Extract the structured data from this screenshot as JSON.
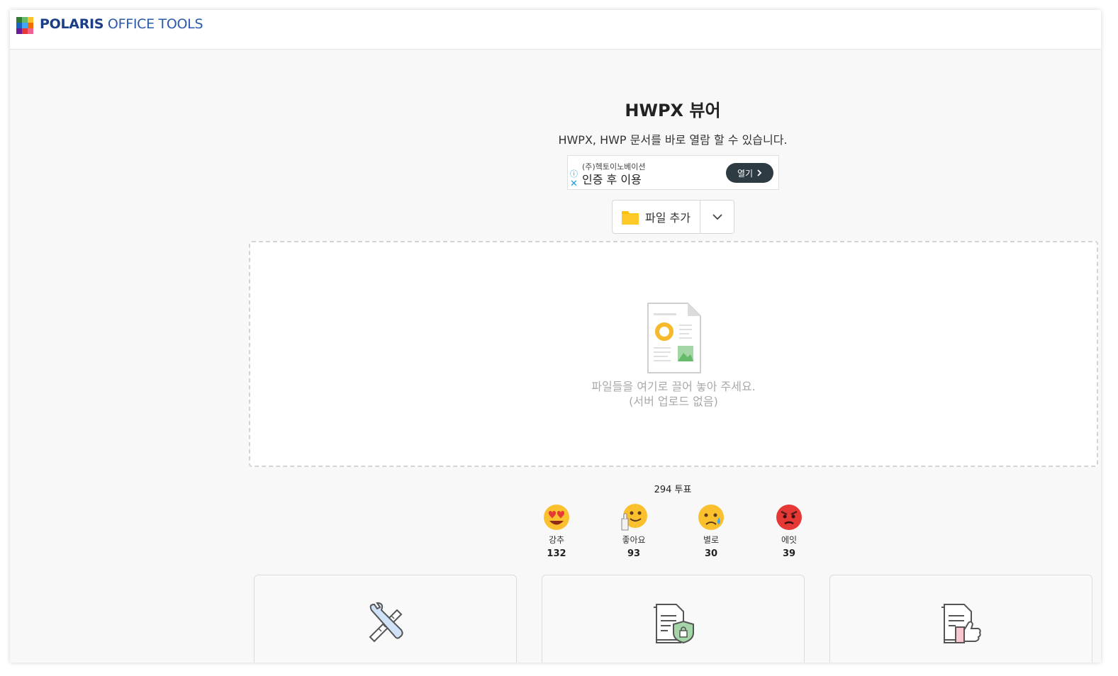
{
  "header": {
    "brand_bold": "POLARIS",
    "brand_light": " OFFICE TOOLS",
    "logo_icon": "polaris-logo-icon"
  },
  "main": {
    "title": "HWPX 뷰어",
    "subtitle": "HWPX, HWP 문서를 바로 열람 할 수 있습니다."
  },
  "ad": {
    "advertiser": "(주)헥토이노베이션",
    "headline": "인증 후 이용",
    "open_label": "열기",
    "info_icon": "ⓘ",
    "close_icon": "✕"
  },
  "file_button": {
    "label": "파일 추가",
    "icon": "folder-icon",
    "dropdown_icon": "chevron-down-icon"
  },
  "dropzone": {
    "hint_line1": "파일들을 여기로 끌어 놓아 주세요.",
    "hint_line2": "(서버 업로드 없음)"
  },
  "feedback": {
    "total_votes": "294 투표",
    "reactions": [
      {
        "label": "강추",
        "count": "132",
        "icon": "heart-eyes-emoji-icon"
      },
      {
        "label": "좋아요",
        "count": "93",
        "icon": "thumbs-up-emoji-icon"
      },
      {
        "label": "별로",
        "count": "30",
        "icon": "sad-emoji-icon"
      },
      {
        "label": "에잇",
        "count": "39",
        "icon": "angry-emoji-icon"
      }
    ]
  },
  "tools": [
    {
      "icon": "wrench-ruler-icon"
    },
    {
      "icon": "document-lock-icon"
    },
    {
      "icon": "document-thumbs-up-icon"
    }
  ],
  "colors": {
    "brand_dark": "#1a3f86",
    "brand": "#2a5aa8",
    "ad_button": "#2f3b43",
    "folder": "#ffc107"
  }
}
